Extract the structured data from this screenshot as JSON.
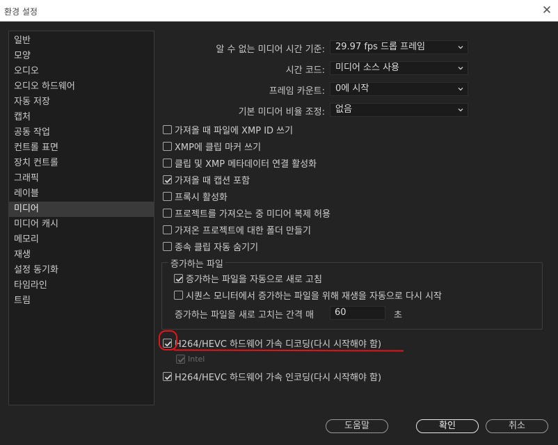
{
  "window": {
    "title": "환경 설정",
    "close_glyph": "✕"
  },
  "sidebar": {
    "items": [
      {
        "label": "일반",
        "active": false
      },
      {
        "label": "모양",
        "active": false
      },
      {
        "label": "오디오",
        "active": false
      },
      {
        "label": "오디오 하드웨어",
        "active": false
      },
      {
        "label": "자동 저장",
        "active": false
      },
      {
        "label": "캡처",
        "active": false
      },
      {
        "label": "공동 작업",
        "active": false
      },
      {
        "label": "컨트롤 표면",
        "active": false
      },
      {
        "label": "장치 컨트롤",
        "active": false
      },
      {
        "label": "그래픽",
        "active": false
      },
      {
        "label": "레이블",
        "active": false
      },
      {
        "label": "미디어",
        "active": true
      },
      {
        "label": "미디어 캐시",
        "active": false
      },
      {
        "label": "메모리",
        "active": false
      },
      {
        "label": "재생",
        "active": false
      },
      {
        "label": "설정 동기화",
        "active": false
      },
      {
        "label": "타임라인",
        "active": false
      },
      {
        "label": "트림",
        "active": false
      }
    ]
  },
  "fields": {
    "timebase": {
      "label": "알 수 없는 미디어 시간 기준:",
      "value": "29.97 fps 드롭 프레임"
    },
    "timecode": {
      "label": "시간 코드:",
      "value": "미디어 소스 사용"
    },
    "frame_count": {
      "label": "프레임 카운트:",
      "value": "0에 시작"
    },
    "pixel_aspect": {
      "label": "기본 미디어 비율 조정:",
      "value": "없음"
    }
  },
  "checkboxes": [
    {
      "label": "가져올 때 파일에 XMP ID 쓰기",
      "checked": false
    },
    {
      "label": "XMP에 클립 마커 쓰기",
      "checked": false
    },
    {
      "label": "클립 및 XMP 메타데이터 연결 활성화",
      "checked": false
    },
    {
      "label": "가져올 때 캡션 포함",
      "checked": true
    },
    {
      "label": "프록시 활성화",
      "checked": false
    },
    {
      "label": "프로젝트를 가져오는 중 미디어 복제 허용",
      "checked": false
    },
    {
      "label": "가져온 프로젝트에 대한 폴더 만들기",
      "checked": false
    },
    {
      "label": "종속 클립 자동 숨기기",
      "checked": false
    }
  ],
  "growing_files": {
    "title": "증가하는 파일",
    "auto_refresh": {
      "label": "증가하는 파일을 자동으로 새로 고침",
      "checked": true
    },
    "restart_playback": {
      "label": "시퀀스 모니터에서 증가하는 파일을 위해 재생을 자동으로 다시 시작",
      "checked": false
    },
    "interval_label": "증가하는 파일을 새로 고치는 간격 매",
    "interval_value": "60",
    "interval_unit": "초"
  },
  "hardware": {
    "decode": {
      "label": "H264/HEVC 하드웨어 가속 디코딩(다시 시작해야 함)",
      "checked": true
    },
    "intel": {
      "label": "Intel",
      "checked": true,
      "disabled": true
    },
    "encode": {
      "label": "H264/HEVC 하드웨어 가속 인코딩(다시 시작해야 함)",
      "checked": true
    }
  },
  "buttons": {
    "help": "도움말",
    "ok": "확인",
    "cancel": "취소"
  },
  "annotation_color": "#e0161c"
}
